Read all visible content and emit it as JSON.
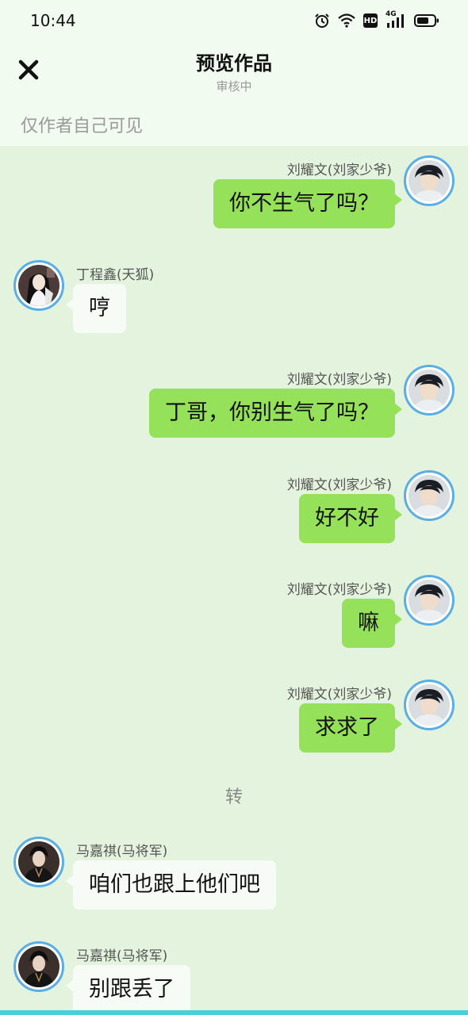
{
  "status_bar": {
    "time": "10:44",
    "icons": [
      "alarm-icon",
      "wifi-icon",
      "hd-icon",
      "4g-signal-icon",
      "battery-icon"
    ],
    "hd_label": "HD",
    "net_label": "4G"
  },
  "header": {
    "title": "预览作品",
    "subtitle": "审核中",
    "close_icon": "close-icon",
    "visibility": "仅作者自己可见"
  },
  "colors": {
    "top_bg": "#f1fbef",
    "chat_bg": "#e4f3dd",
    "bubble_right": "#95e15a",
    "bubble_left": "#f7fbf5",
    "avatar_border": "#5aaee6",
    "bottom_strip": "#49d0d6"
  },
  "messages": [
    {
      "side": "right",
      "name": "刘耀文(刘家少爷)",
      "text": "你不生气了吗？"
    },
    {
      "side": "left",
      "name": "丁程鑫(天狐)",
      "text": "哼"
    },
    {
      "side": "right",
      "name": "刘耀文(刘家少爷)",
      "text": "丁哥，你别生气了吗？"
    },
    {
      "side": "right",
      "name": "刘耀文(刘家少爷)",
      "text": "好不好"
    },
    {
      "side": "right",
      "name": "刘耀文(刘家少爷)",
      "text": "嘛"
    },
    {
      "side": "right",
      "name": "刘耀文(刘家少爷)",
      "text": "求求了"
    },
    {
      "side": "center",
      "text": "转"
    },
    {
      "side": "left",
      "name": "马嘉祺(马将军)",
      "text": "咱们也跟上他们吧"
    },
    {
      "side": "left",
      "name": "马嘉祺(马将军)",
      "text": "别跟丢了"
    }
  ]
}
